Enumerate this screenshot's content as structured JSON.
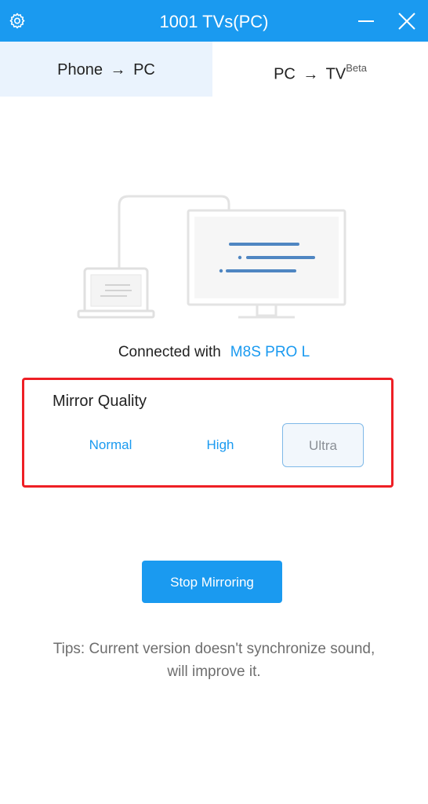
{
  "window": {
    "title": "1001 TVs(PC)",
    "settings_icon": "gear-icon",
    "minimize_icon": "minimize-icon",
    "close_icon": "close-icon",
    "accent_color": "#1a9af0"
  },
  "tabs": [
    {
      "from": "Phone",
      "arrow": "→",
      "to": "PC",
      "badge": "",
      "active": true
    },
    {
      "from": "PC",
      "arrow": "→",
      "to": "TV",
      "badge": "Beta",
      "active": false
    }
  ],
  "status": {
    "connected_label": "Connected with",
    "device_name": "M8S PRO L"
  },
  "quality": {
    "label": "Mirror Quality",
    "options": [
      "Normal",
      "High",
      "Ultra"
    ],
    "selected": "Ultra",
    "highlight_color": "#ee1f25"
  },
  "actions": {
    "stop_label": "Stop Mirroring"
  },
  "tips": {
    "line1": "Tips: Current version doesn't synchronize sound,",
    "line2": "will improve it."
  }
}
